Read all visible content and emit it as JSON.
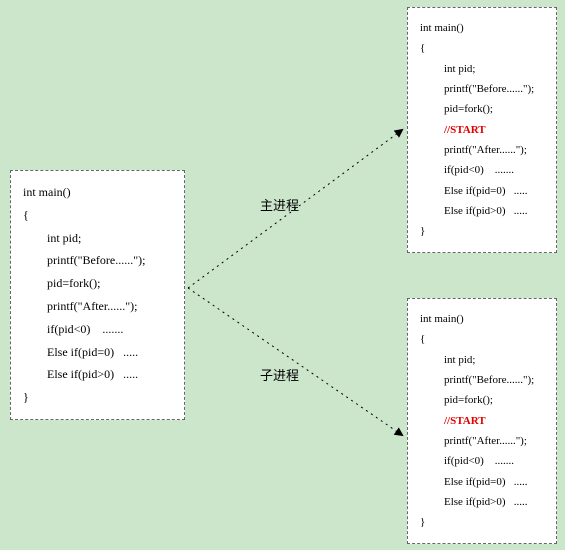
{
  "left_box": {
    "l1": "int main()",
    "l2": "{",
    "l3": "int pid;",
    "l4": "printf(\"Before......\");",
    "l5": "pid=fork();",
    "l6": "printf(\"After......\");",
    "l7": "if(pid<0)    .......",
    "l8": "Else if(pid=0)   .....",
    "l9": "Else if(pid>0)   .....",
    "l10": "}"
  },
  "top_box": {
    "l1": "int main()",
    "l2": "{",
    "l3": "int pid;",
    "l4": "printf(\"Before......\");",
    "l5": "pid=fork();",
    "l6": "//START",
    "l7": "printf(\"After......\");",
    "l8": "if(pid<0)    .......",
    "l9": "Else if(pid=0)   .....",
    "l10": "Else if(pid>0)   .....",
    "l11": "}"
  },
  "bottom_box": {
    "l1": "int main()",
    "l2": "{",
    "l3": "int pid;",
    "l4": "printf(\"Before......\");",
    "l5": "pid=fork();",
    "l6": "//START",
    "l7": "printf(\"After......\");",
    "l8": "if(pid<0)    .......",
    "l9": "Else if(pid=0)   .....",
    "l10": "Else if(pid>0)   .....",
    "l11": "}"
  },
  "labels": {
    "main_process": "主进程",
    "child_process": "子进程"
  }
}
